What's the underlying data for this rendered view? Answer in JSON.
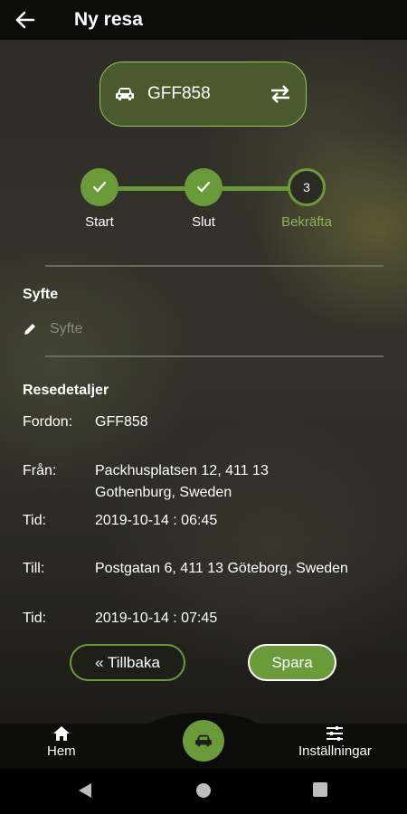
{
  "header": {
    "title": "Ny resa",
    "back_icon": "arrow-left-icon"
  },
  "vehicle": {
    "plate": "GFF858",
    "car_icon": "car-icon",
    "swap_icon": "swap-icon"
  },
  "stepper": {
    "steps": [
      {
        "label": "Start",
        "state": "done"
      },
      {
        "label": "Slut",
        "state": "done"
      },
      {
        "label": "Bekräfta",
        "state": "current",
        "number": "3"
      }
    ],
    "accent_color": "#6a9a3a"
  },
  "purpose": {
    "heading": "Syfte",
    "placeholder": "Syfte",
    "value": ""
  },
  "details": {
    "heading": "Resedetaljer",
    "vehicle_label": "Fordon:",
    "vehicle_value": "GFF858",
    "from_label": "Från:",
    "from_value": "Packhusplatsen 12, 411 13 Gothenburg, Sweden",
    "from_time_label": "Tid:",
    "from_time_value": "2019-10-14 : 06:45",
    "to_label": "Till:",
    "to_value": "Postgatan 6, 411 13 Göteborg, Sweden",
    "to_time_label": "Tid:",
    "to_time_value": "2019-10-14 : 07:45"
  },
  "actions": {
    "back_label": "« Tillbaka",
    "save_label": "Spara"
  },
  "bottom_nav": {
    "home_label": "Hem",
    "settings_label": "Inställningar",
    "home_icon": "home-icon",
    "center_icon": "car-icon",
    "settings_icon": "sliders-icon"
  }
}
